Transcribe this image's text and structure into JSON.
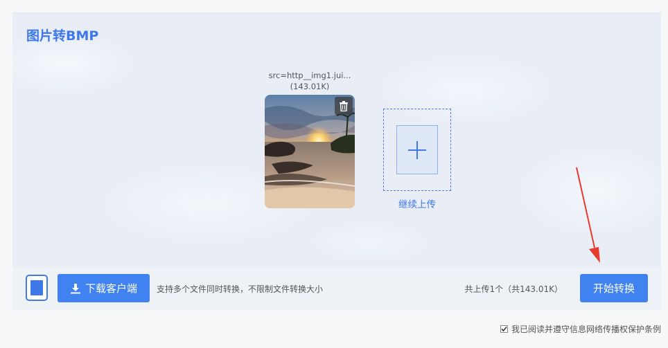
{
  "page": {
    "title": "图片转BMP"
  },
  "file": {
    "name": "src=http__img1.jui...",
    "size": "(143.01K)"
  },
  "upload": {
    "more_label": "继续上传"
  },
  "bottom": {
    "download_label": "下载客户端",
    "tip": "支持多个文件同时转换，不限制文件转换大小",
    "total": "共上传1个（共143.01K）",
    "start_label": "开始转换"
  },
  "agreement": {
    "checked": true,
    "label": "我已阅读并遵守信息网络传播权保护条例"
  },
  "colors": {
    "accent": "#3f82f0",
    "title": "#3f78e8",
    "annotation_arrow": "#e8392f"
  },
  "icons": {
    "delete": "trash-icon",
    "add": "plus-icon",
    "download": "download-icon",
    "device": "tablet-icon",
    "checkbox": "checkmark-icon"
  }
}
